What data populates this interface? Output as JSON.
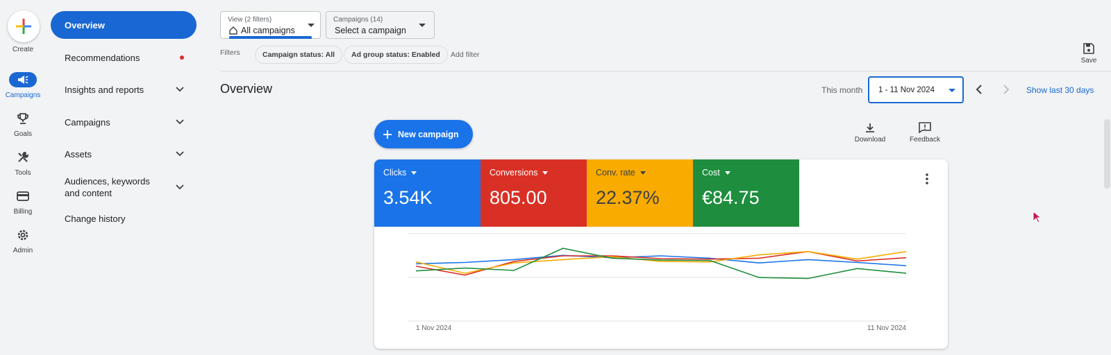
{
  "rail": {
    "create_label": "Create",
    "items": [
      {
        "label": "Campaigns",
        "icon": "megaphone-icon"
      },
      {
        "label": "Goals",
        "icon": "trophy-icon"
      },
      {
        "label": "Tools",
        "icon": "tools-icon"
      },
      {
        "label": "Billing",
        "icon": "credit-card-icon"
      },
      {
        "label": "Admin",
        "icon": "gear-icon"
      }
    ]
  },
  "nav": {
    "overview": "Overview",
    "recommendations": "Recommendations",
    "insights": "Insights and reports",
    "campaigns": "Campaigns",
    "assets": "Assets",
    "audiences": "Audiences, keywords and content",
    "change_history": "Change history"
  },
  "top": {
    "view_label": "View (2 filters)",
    "view_value": "All campaigns",
    "campaigns_label": "Campaigns (14)",
    "campaigns_value": "Select a campaign",
    "filters_label": "Filters",
    "chip1": "Campaign status: All",
    "chip2": "Ad group status: Enabled",
    "add_filter": "Add filter",
    "save": "Save"
  },
  "overview": {
    "title": "Overview",
    "range_label": "This month",
    "date_range": "1 - 11 Nov 2024",
    "show_last": "Show last 30 days",
    "new_campaign": "New campaign",
    "download": "Download",
    "feedback": "Feedback"
  },
  "metrics": [
    {
      "label": "Clicks",
      "value": "3.54K",
      "color": "#1a73e8"
    },
    {
      "label": "Conversions",
      "value": "805.00",
      "color": "#d93025"
    },
    {
      "label": "Conv. rate",
      "value": "22.37%",
      "color": "#f9ab00"
    },
    {
      "label": "Cost",
      "value": "€84.75",
      "color": "#1e8e3e"
    }
  ],
  "chart_data": {
    "type": "line",
    "x_start_label": "1 Nov 2024",
    "x_end_label": "11 Nov 2024",
    "x": [
      1,
      2,
      3,
      4,
      5,
      6,
      7,
      8,
      9,
      10,
      11
    ],
    "grid": true,
    "series": [
      {
        "name": "Clicks",
        "color": "#1a73e8",
        "values": [
          0.64,
          0.61,
          0.55,
          0.46,
          0.51,
          0.47,
          0.52,
          0.62,
          0.55,
          0.61,
          0.68
        ]
      },
      {
        "name": "Conversions",
        "color": "#d93025",
        "values": [
          0.69,
          0.88,
          0.59,
          0.47,
          0.47,
          0.53,
          0.54,
          0.52,
          0.38,
          0.58,
          0.51
        ]
      },
      {
        "name": "Conv. rate",
        "color": "#f9ab00",
        "values": [
          0.6,
          0.84,
          0.62,
          0.55,
          0.49,
          0.59,
          0.6,
          0.45,
          0.38,
          0.54,
          0.38
        ]
      },
      {
        "name": "Cost",
        "color": "#1e8e3e",
        "values": [
          0.79,
          0.73,
          0.78,
          0.31,
          0.52,
          0.56,
          0.57,
          0.93,
          0.95,
          0.74,
          0.84
        ]
      }
    ]
  }
}
